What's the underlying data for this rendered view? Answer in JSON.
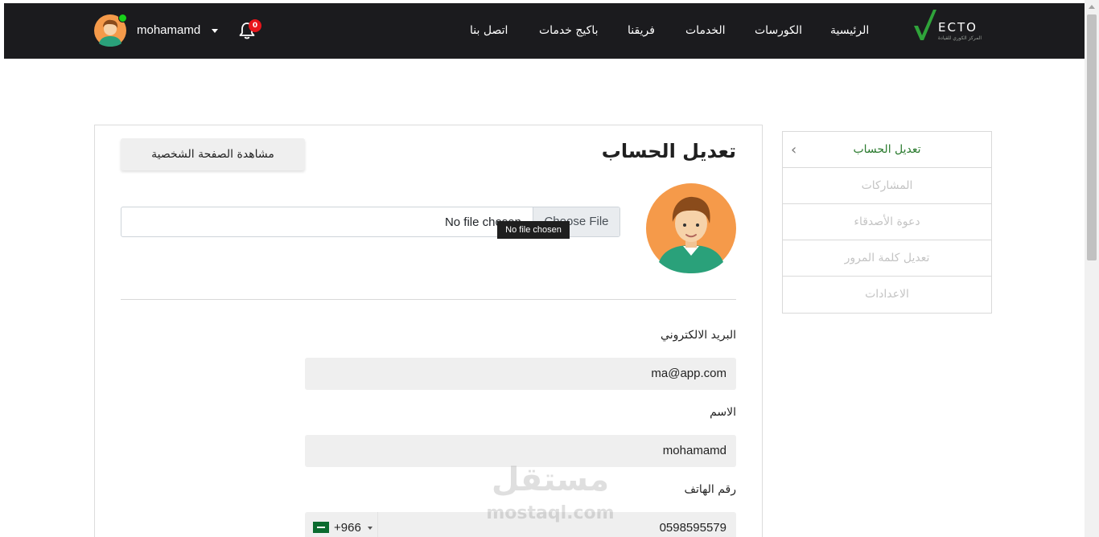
{
  "navbar": {
    "logo_text": "ECTO",
    "logo_subtext": "المركز الكوري للقيادة",
    "links": [
      "الرئيسية",
      "الكورسات",
      "الخدمات",
      "فريقنا",
      "باكيج خدمات",
      "اتصل بنا"
    ],
    "notification_count": "0",
    "username": "mohamamd"
  },
  "profile": {
    "title": "تعديل الحساب",
    "view_profile_label": "مشاهدة الصفحة الشخصية",
    "file_status": "No file chosen",
    "file_button": "Choose File",
    "tooltip": "No file chosen"
  },
  "form": {
    "email_label": "البريد الالكتروني",
    "email_value": "ma@app.com",
    "name_label": "الاسم",
    "name_value": "mohamamd",
    "phone_label": "رقم الهاتف",
    "dial_code": "+966",
    "phone_value": "0598595579"
  },
  "sidebar": {
    "items": [
      {
        "label": "تعديل الحساب",
        "active": true
      },
      {
        "label": "المشاركات",
        "active": false
      },
      {
        "label": "دعوة الأصدقاء",
        "active": false
      },
      {
        "label": "تعديل كلمة المرور",
        "active": false
      },
      {
        "label": "الاعدادات",
        "active": false
      }
    ]
  },
  "watermark": {
    "arabic": "مستقل",
    "latin": "mostaql.com"
  },
  "colors": {
    "navbar_bg": "#1b1b1e",
    "accent_green": "#2a7a2e",
    "badge_red": "#e8151b",
    "online_green": "#18d11a"
  }
}
